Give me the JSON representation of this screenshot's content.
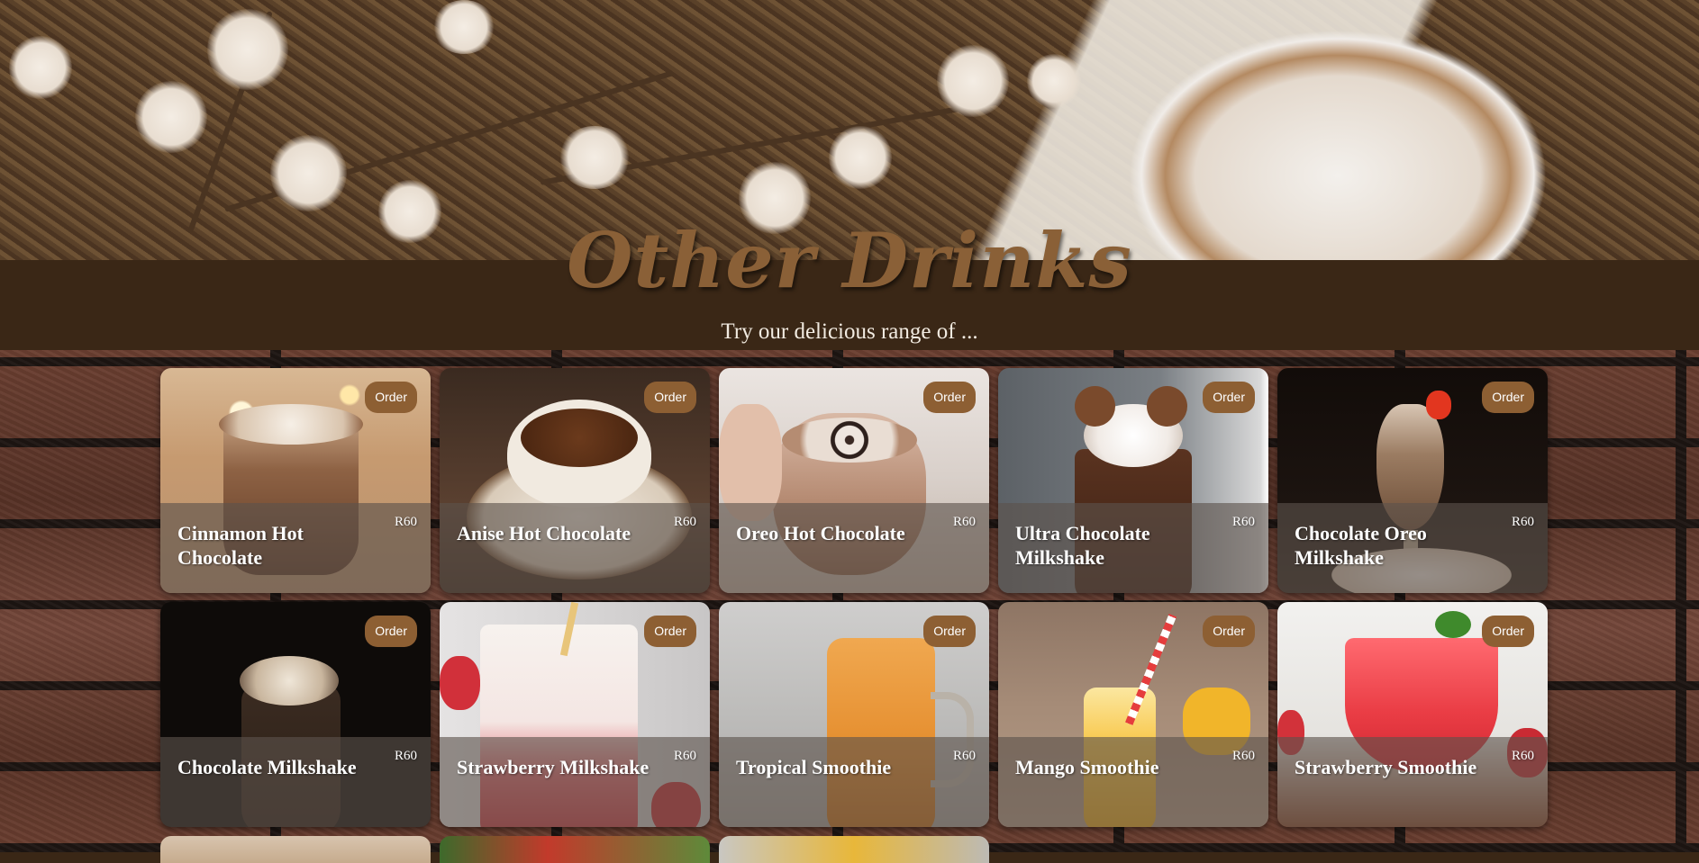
{
  "hero": {
    "title": "Other Drinks",
    "subtitle": "Try our delicious range of ..."
  },
  "card_common": {
    "order_label": "Order"
  },
  "drinks": [
    {
      "name": "Cinnamon Hot Chocolate",
      "price": "R60"
    },
    {
      "name": "Anise Hot Chocolate",
      "price": "R60"
    },
    {
      "name": "Oreo Hot Chocolate",
      "price": "R60"
    },
    {
      "name": "Ultra Chocolate Milkshake",
      "price": "R60"
    },
    {
      "name": "Chocolate Oreo Milkshake",
      "price": "R60"
    },
    {
      "name": "Chocolate Milkshake",
      "price": "R60"
    },
    {
      "name": "Strawberry Milkshake",
      "price": "R60"
    },
    {
      "name": "Tropical Smoothie",
      "price": "R60"
    },
    {
      "name": "Mango Smoothie",
      "price": "R60"
    },
    {
      "name": "Strawberry Smoothie",
      "price": "R60"
    }
  ],
  "colors": {
    "band": "#3a2716",
    "title": "#8a6037",
    "order_button": "#8d5f33",
    "caption_overlay": "#5c524c"
  }
}
